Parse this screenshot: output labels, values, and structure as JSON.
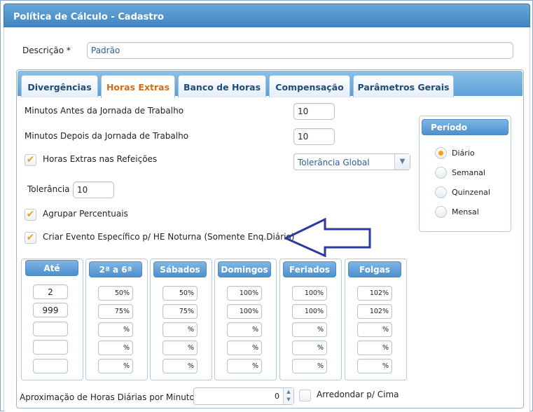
{
  "window": {
    "title": "Política de Cálculo - Cadastro"
  },
  "descricao": {
    "label": "Descrição *",
    "value": "Padrão"
  },
  "tabs": [
    {
      "label": "Divergências"
    },
    {
      "label": "Horas Extras",
      "active": true
    },
    {
      "label": "Banco de Horas"
    },
    {
      "label": "Compensação"
    },
    {
      "label": "Parâmetros Gerais"
    }
  ],
  "horas_extras": {
    "min_antes_label": "Minutos Antes da Jornada de Trabalho",
    "min_antes_value": "10",
    "min_depois_label": "Minutos Depois da Jornada de Trabalho",
    "min_depois_value": "10",
    "refeicoes_label": "Horas Extras nas Refeições",
    "refeicoes_checked": true,
    "tolerancia_select": "Tolerância Global",
    "tolerancia_label": "Tolerância",
    "tolerancia_value": "10",
    "agrupar_label": "Agrupar Percentuais",
    "agrupar_checked": true,
    "evento_label": "Criar Evento Específico p/ HE Noturna (Somente Enq.Diário)",
    "evento_checked": true
  },
  "periodo": {
    "title": "Período",
    "options": [
      {
        "label": "Diário",
        "selected": true
      },
      {
        "label": "Semanal"
      },
      {
        "label": "Quinzenal"
      },
      {
        "label": "Mensal"
      }
    ]
  },
  "columns": {
    "ate": {
      "title": "Até",
      "values": [
        "2",
        "999",
        "",
        "",
        ""
      ]
    },
    "seg_sex": {
      "title": "2ª a 6ª",
      "values": [
        "50%",
        "75%",
        "%",
        "%",
        "%"
      ]
    },
    "sabados": {
      "title": "Sábados",
      "values": [
        "50%",
        "75%",
        "%",
        "%",
        "%"
      ]
    },
    "domingos": {
      "title": "Domingos",
      "values": [
        "100%",
        "100%",
        "%",
        "%",
        "%"
      ]
    },
    "feriados": {
      "title": "Feriados",
      "values": [
        "100%",
        "100%",
        "%",
        "%",
        "%"
      ]
    },
    "folgas": {
      "title": "Folgas",
      "values": [
        "102%",
        "102%",
        "%",
        "%",
        "%"
      ]
    }
  },
  "aproximacao": {
    "label": "Aproximação de Horas Diárias por Minuto",
    "value": "0"
  },
  "arredondar": {
    "label": "Arredondar p/ Cima",
    "checked": false
  },
  "colors": {
    "accent": "#4b8fcd",
    "active_tab": "#d46b16",
    "checkmark": "#f0a020",
    "arrow": "#2b3a9e"
  },
  "icons": {
    "check": "✔",
    "dropdown": "▼",
    "spin_up": "▲",
    "spin_down": "▼",
    "annotation": "left-arrow-outline"
  }
}
